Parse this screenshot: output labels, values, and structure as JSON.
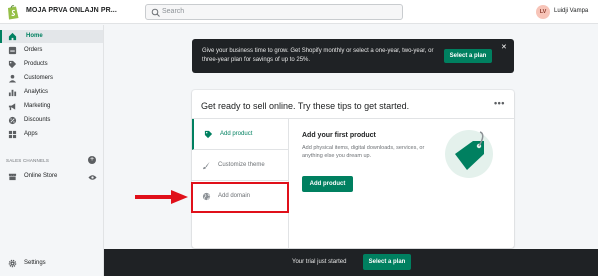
{
  "header": {
    "store_name": "MOJA PRVA ONLAJN PR...",
    "search_placeholder": "Search",
    "user_initials": "LV",
    "user_name": "Luidji Vampa"
  },
  "sidebar": {
    "items": [
      {
        "label": "Home",
        "icon": "home-icon"
      },
      {
        "label": "Orders",
        "icon": "orders-icon"
      },
      {
        "label": "Products",
        "icon": "tag-icon"
      },
      {
        "label": "Customers",
        "icon": "person-icon"
      },
      {
        "label": "Analytics",
        "icon": "bar-chart-icon"
      },
      {
        "label": "Marketing",
        "icon": "megaphone-icon"
      },
      {
        "label": "Discounts",
        "icon": "discount-icon"
      },
      {
        "label": "Apps",
        "icon": "apps-icon"
      }
    ],
    "sales_channels_title": "SALES CHANNELS",
    "channels": [
      {
        "label": "Online Store",
        "icon": "store-icon"
      }
    ],
    "settings_label": "Settings"
  },
  "banner": {
    "text": "Give your business time to grow. Get Shopify monthly or select a one-year, two-year, or three-year plan for savings of up to 25%.",
    "button_label": "Select a plan",
    "close_label": "✕"
  },
  "tips_card": {
    "title": "Get ready to sell online. Try these tips to get started.",
    "more_label": "•••",
    "tips": [
      {
        "label": "Add product",
        "icon": "tag-icon"
      },
      {
        "label": "Customize theme",
        "icon": "brush-icon"
      },
      {
        "label": "Add domain",
        "icon": "globe-icon"
      }
    ],
    "content_title": "Add your first product",
    "content_desc": "Add physical items, digital downloads, services, or anything else you dream up.",
    "content_button": "Add product"
  },
  "bottom_bar": {
    "text": "Your trial just started",
    "button_label": "Select a plan"
  },
  "colors": {
    "accent": "#008060",
    "dark": "#1f2225",
    "annotation": "#e0101a"
  }
}
